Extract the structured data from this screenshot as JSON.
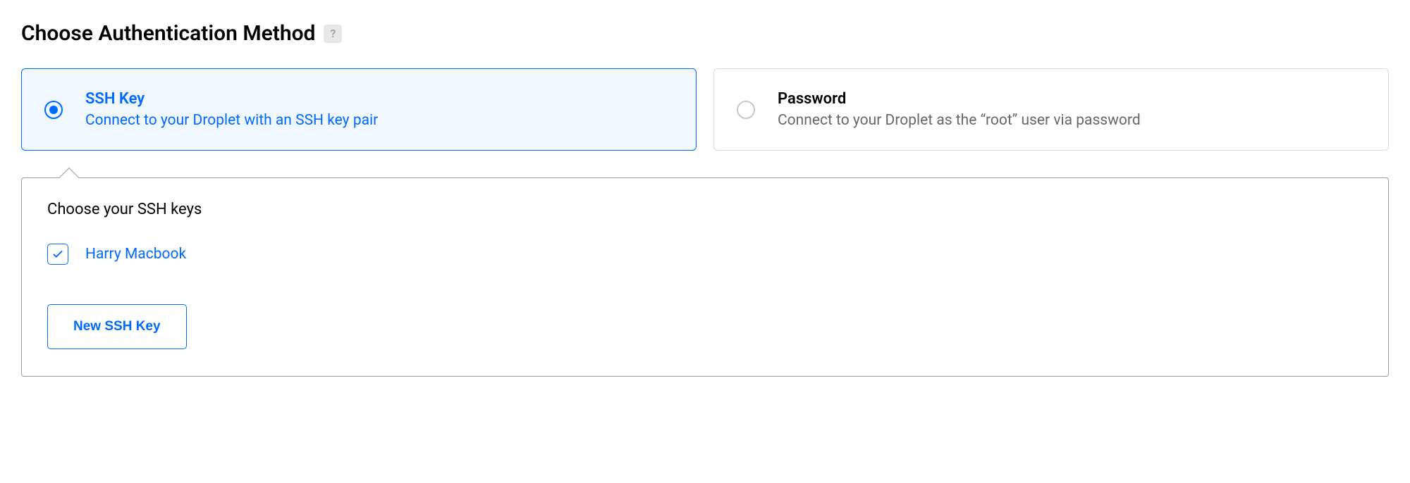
{
  "header": {
    "title": "Choose Authentication Method",
    "help": "?"
  },
  "auth": {
    "ssh": {
      "title": "SSH Key",
      "desc": "Connect to your Droplet with an SSH key pair"
    },
    "password": {
      "title": "Password",
      "desc": "Connect to your Droplet as the “root” user via password"
    }
  },
  "sshPanel": {
    "title": "Choose your SSH keys",
    "keys": [
      {
        "label": "Harry Macbook"
      }
    ],
    "newButton": "New SSH Key"
  }
}
